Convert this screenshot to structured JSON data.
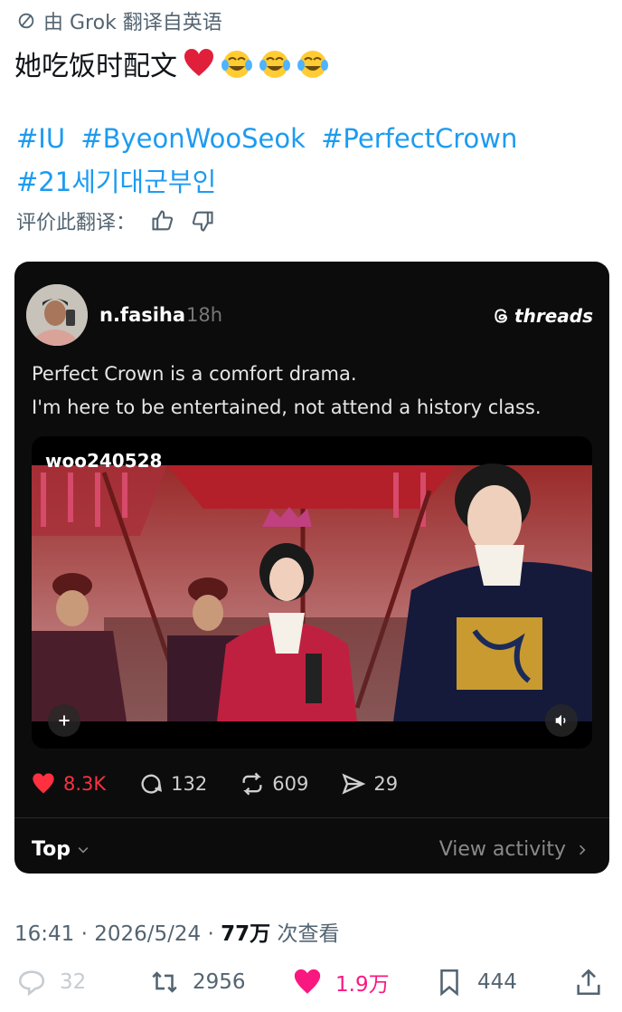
{
  "translation": {
    "label": "由 Grok 翻译自英语"
  },
  "post": {
    "text": "她吃饭时配文",
    "emojis": [
      "red-heart",
      "tears-of-joy",
      "tears-of-joy",
      "tears-of-joy"
    ],
    "hashtags_line1": [
      "#IU",
      "#ByeonWooSeok",
      "#PerfectCrown"
    ],
    "hashtags_line2": [
      "#21세기대군부인"
    ],
    "rate_label": "评价此翻译："
  },
  "card": {
    "username": "n.fasiha",
    "time": "18h",
    "brand": "threads",
    "text_line1": "Perfect Crown is a comfort drama.",
    "text_line2": "I'm here to be entertained, not attend a history class.",
    "video_watermark": "woo240528",
    "actions": {
      "likes": "8.3K",
      "comments": "132",
      "reposts": "609",
      "shares": "29"
    },
    "sort_label": "Top",
    "view_activity": "View activity"
  },
  "meta": {
    "time": "16:41",
    "date": "2026/5/24",
    "views": "77万",
    "views_suffix": "次查看"
  },
  "engagement": {
    "replies": "32",
    "reposts": "2956",
    "likes": "1.9万",
    "bookmarks": "444"
  },
  "colors": {
    "link": "#1d9bf0",
    "like": "#f91880",
    "threads_like": "#ff3040",
    "muted": "#536471"
  }
}
